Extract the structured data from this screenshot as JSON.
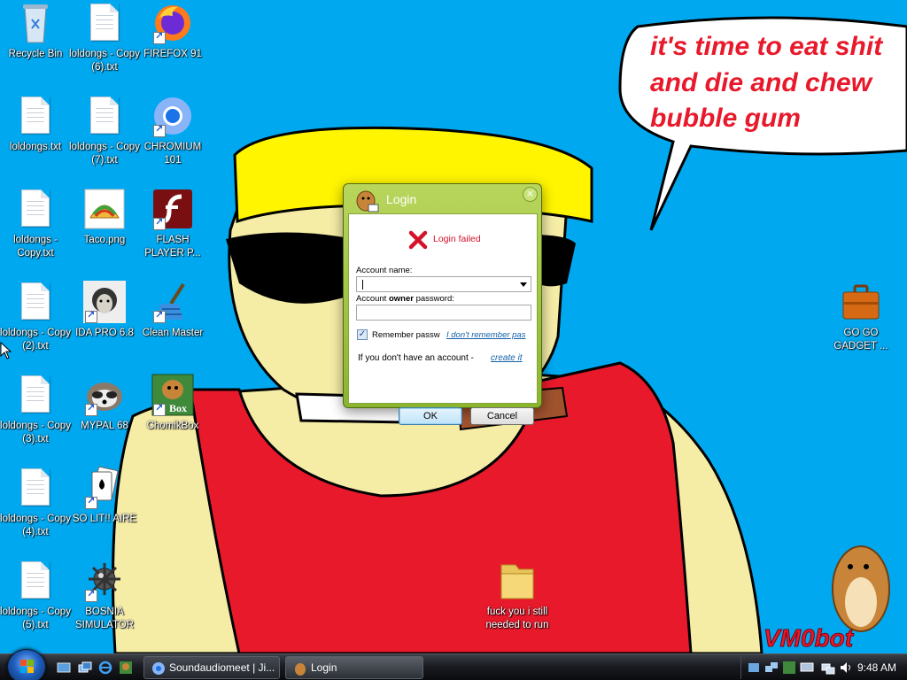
{
  "wallpaper": {
    "speech_line1": "it's time to eat shit",
    "speech_line2": "and die and chew",
    "speech_line3": "bubble gum",
    "signature": "VM0bot"
  },
  "desktop_icons": {
    "recycle_bin": "Recycle Bin",
    "copy6": "loldongs - Copy (6).txt",
    "firefox": "FIREFOX 91",
    "loldongs": "loldongs.txt",
    "copy7": "loldongs - Copy (7).txt",
    "chromium": "CHROMIUM 101",
    "copy": "loldongs - Copy.txt",
    "taco": "Taco.png",
    "flash": "FLASH PLAYER P...",
    "copy2": "loldongs - Copy (2).txt",
    "ida": "IDA PRO 6.8",
    "cleanmaster": "Clean Master",
    "copy3": "loldongs - Copy (3).txt",
    "mypal": "MYPAL 68",
    "chomikbox": "ChomikBox",
    "copy4": "loldongs - Copy (4).txt",
    "solitaire": "SO LIT!! AIRE",
    "copy5": "loldongs - Copy (5).txt",
    "bosnia": "BOSNIA SIMULATOR",
    "gogadget": "GO GO GADGET ...",
    "folder": "fuck you i still needed to run"
  },
  "dialog": {
    "title": "Login",
    "close": "×",
    "error": "Login failed",
    "account_name_label": "Account name:",
    "password_label_pre": "Account ",
    "password_label_bold": "owner",
    "password_label_post": " password:",
    "remember_label": "Remember passw",
    "forgot_link": "I don't remember pas",
    "no_account_text": "If you don't have an account - ",
    "create_link": "create it",
    "ok": "OK",
    "cancel": "Cancel"
  },
  "taskbar": {
    "task1": "Soundaudiomeet | Ji...",
    "task2": "Login",
    "clock": "9:48 AM"
  },
  "colors": {
    "desktop_bg": "#00a8f0",
    "dialog_green": "#9cc33a",
    "error_red": "#d4122b"
  }
}
